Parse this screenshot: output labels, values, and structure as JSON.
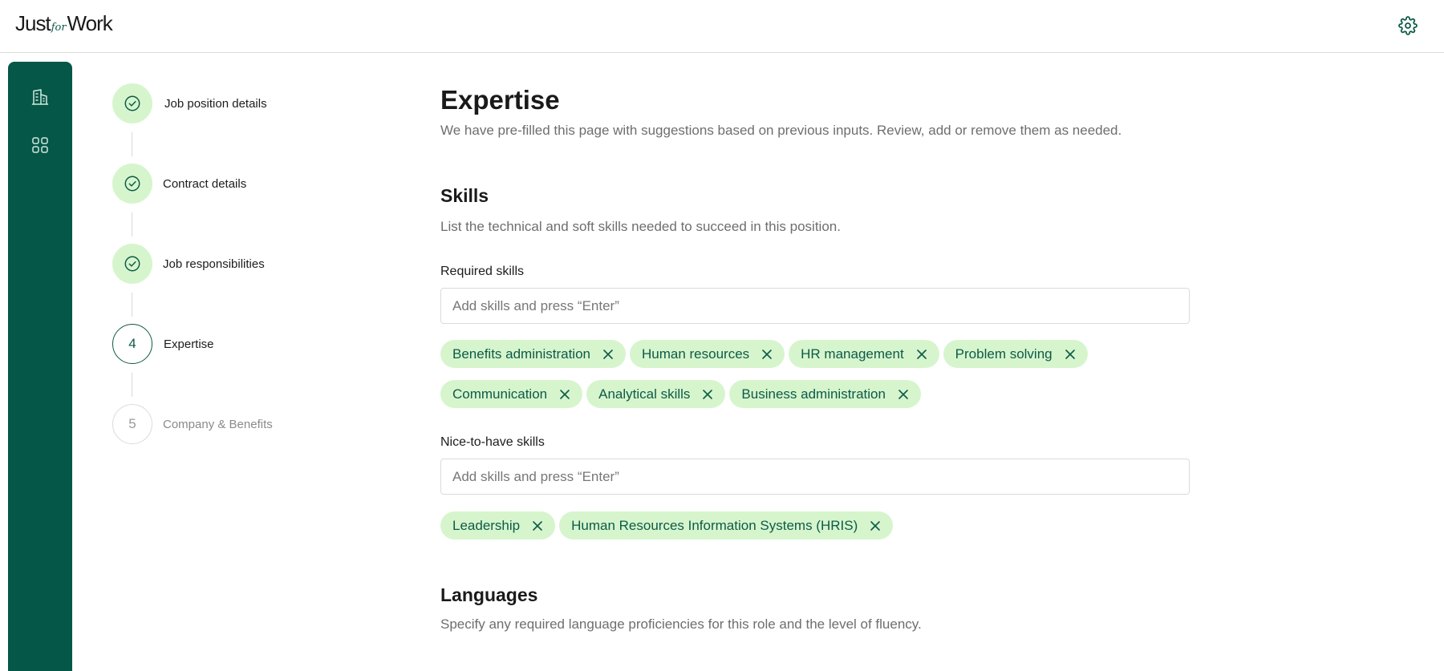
{
  "app": {
    "logo_main_left": "Just",
    "logo_for": "for",
    "logo_main_right": "Work",
    "settings_icon": "gear-icon",
    "colors": {
      "brand": "#055747",
      "accent": "#0e5a48",
      "chip_bg": "#d6f5cd"
    }
  },
  "rail": {
    "items": [
      {
        "icon": "building-icon"
      },
      {
        "icon": "grid-icon"
      }
    ]
  },
  "steps": [
    {
      "label": "Job position details",
      "status": "done"
    },
    {
      "label": "Contract details",
      "status": "done"
    },
    {
      "label": "Job responsibilities",
      "status": "done"
    },
    {
      "label": "Expertise",
      "number": "4",
      "status": "active"
    },
    {
      "label": "Company & Benefits",
      "number": "5",
      "status": "todo"
    }
  ],
  "page": {
    "title": "Expertise",
    "subtitle": "We have pre-filled this page with suggestions based on previous inputs. Review, add or remove them as needed."
  },
  "skills": {
    "heading": "Skills",
    "description": "List the technical and soft skills needed to succeed in this position.",
    "required": {
      "label": "Required skills",
      "placeholder": "Add skills and press “Enter”",
      "value": "",
      "chips": [
        "Benefits administration",
        "Human resources",
        "HR management",
        "Problem solving",
        "Communication",
        "Analytical skills",
        "Business administration"
      ]
    },
    "nice": {
      "label": "Nice-to-have skills",
      "placeholder": "Add skills and press “Enter”",
      "value": "",
      "chips": [
        "Leadership",
        "Human Resources Information Systems (HRIS)"
      ]
    }
  },
  "languages": {
    "heading": "Languages",
    "description": "Specify any required language proficiencies for this role and the level of fluency."
  }
}
